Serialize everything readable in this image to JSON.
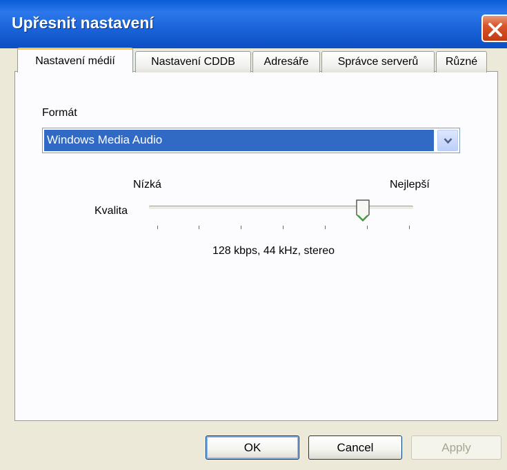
{
  "window": {
    "title": "Upřesnit nastavení",
    "close_icon": "close-icon",
    "accent": "#0a5bd8"
  },
  "tabs": [
    {
      "label": "Nastavení médií",
      "active": true
    },
    {
      "label": "Nastavení CDDB",
      "active": false
    },
    {
      "label": "Adresáře",
      "active": false
    },
    {
      "label": "Správce serverů",
      "active": false
    },
    {
      "label": "Různé",
      "active": false
    }
  ],
  "media": {
    "format_label": "Formát",
    "format_value": "Windows Media Audio",
    "quality_label": "Kvalita",
    "low_label": "Nízká",
    "high_label": "Nejlepší",
    "quality_fraction": 0.83,
    "quality_info": "128 kbps, 44 kHz, stereo"
  },
  "buttons": {
    "ok": "OK",
    "cancel": "Cancel",
    "apply": "Apply"
  }
}
